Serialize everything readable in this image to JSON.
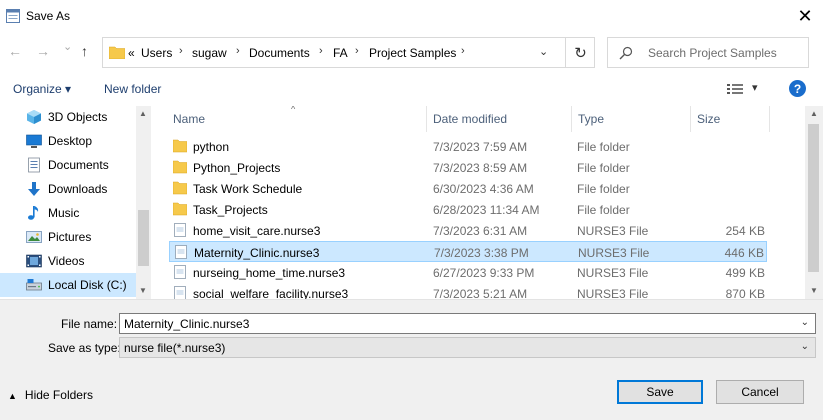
{
  "window": {
    "title": "Save As",
    "close_glyph": "✕",
    "icon": "save-as-app-icon"
  },
  "nav": {
    "back_glyph": "←",
    "forward_glyph": "→",
    "recent_glyph": "⌄",
    "up_glyph": "↑",
    "overflow": "«",
    "breadcrumb": [
      "Users",
      "sugaw",
      "Documents",
      "FA",
      "Project Samples"
    ],
    "separator": "›",
    "dropdown_glyph": "⌄",
    "refresh_glyph": "↻",
    "search_placeholder": "Search Project Samples"
  },
  "toolbar": {
    "organize": "Organize ▾",
    "new_folder": "New folder",
    "view_caret": "▾",
    "help": "?"
  },
  "sidebar": {
    "items": [
      {
        "label": "3D Objects",
        "icon": "3d-objects-icon"
      },
      {
        "label": "Desktop",
        "icon": "desktop-icon"
      },
      {
        "label": "Documents",
        "icon": "documents-icon"
      },
      {
        "label": "Downloads",
        "icon": "downloads-icon"
      },
      {
        "label": "Music",
        "icon": "music-icon"
      },
      {
        "label": "Pictures",
        "icon": "pictures-icon"
      },
      {
        "label": "Videos",
        "icon": "videos-icon"
      },
      {
        "label": "Local Disk (C:)",
        "icon": "local-disk-icon",
        "selected": true
      }
    ]
  },
  "files": {
    "columns": {
      "name": "Name",
      "date": "Date modified",
      "type": "Type",
      "size": "Size"
    },
    "rows": [
      {
        "name": "python",
        "date": "7/3/2023 7:59 AM",
        "type": "File folder",
        "size": "",
        "kind": "folder"
      },
      {
        "name": "Python_Projects",
        "date": "7/3/2023 8:59 AM",
        "type": "File folder",
        "size": "",
        "kind": "folder"
      },
      {
        "name": "Task Work Schedule",
        "date": "6/30/2023 4:36 AM",
        "type": "File folder",
        "size": "",
        "kind": "folder"
      },
      {
        "name": "Task_Projects",
        "date": "6/28/2023 11:34 AM",
        "type": "File folder",
        "size": "",
        "kind": "folder"
      },
      {
        "name": "home_visit_care.nurse3",
        "date": "7/3/2023 6:31 AM",
        "type": "NURSE3 File",
        "size": "254 KB",
        "kind": "file"
      },
      {
        "name": "Maternity_Clinic.nurse3",
        "date": "7/3/2023 3:38 PM",
        "type": "NURSE3 File",
        "size": "446 KB",
        "kind": "file",
        "selected": true
      },
      {
        "name": "nurseing_home_time.nurse3",
        "date": "6/27/2023 9:33 PM",
        "type": "NURSE3 File",
        "size": "499 KB",
        "kind": "file"
      },
      {
        "name": "social_welfare_facility.nurse3",
        "date": "7/3/2023 5:21 AM",
        "type": "NURSE3 File",
        "size": "870 KB",
        "kind": "file"
      }
    ]
  },
  "form": {
    "file_name_label": "File name:",
    "file_name_value": "Maternity_Clinic.nurse3",
    "save_type_label": "Save as type:",
    "save_type_value": "nurse file(*.nurse3)",
    "chevron": "⌄"
  },
  "footer": {
    "hide_folders": "Hide Folders",
    "hide_caret": "▲",
    "save": "Save",
    "cancel": "Cancel"
  },
  "colors": {
    "selection": "#cce8ff",
    "accent": "#0078d7",
    "folder": "#f6c94b"
  }
}
